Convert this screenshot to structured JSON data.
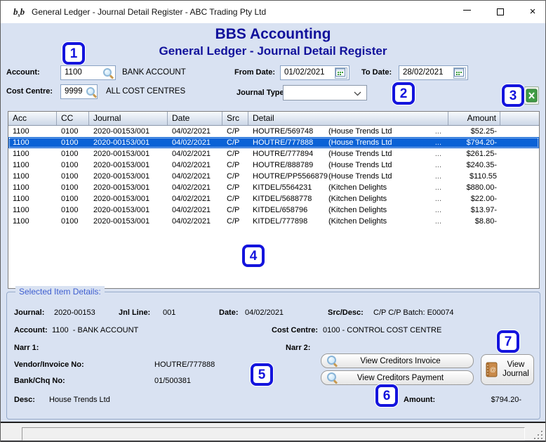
{
  "window": {
    "title": "General Ledger - Journal Detail Register - ABC Trading Pty Ltd",
    "logo_text": "b",
    "logo_sub": "s",
    "logo_text2": "b",
    "close_glyph": "×"
  },
  "header": {
    "app_title": "BBS Accounting",
    "screen_title": "General Ledger - Journal Detail Register"
  },
  "filters": {
    "account": {
      "label": "Account:",
      "value": "1100",
      "desc": "BANK ACCOUNT"
    },
    "cost_centre": {
      "label": "Cost Centre:",
      "value": "9999",
      "desc": "ALL COST CENTRES"
    },
    "from_date": {
      "label": "From Date:",
      "value": "01/02/2021"
    },
    "to_date": {
      "label": "To Date:",
      "value": "28/02/2021"
    },
    "journal_type": {
      "label": "Journal Type:",
      "value": ""
    }
  },
  "callouts": [
    "1",
    "2",
    "3",
    "4",
    "5",
    "6",
    "7"
  ],
  "table": {
    "columns": [
      "Acc",
      "CC",
      "Journal",
      "Date",
      "Src",
      "Detail",
      "Amount"
    ],
    "rows": [
      {
        "acc": "1100",
        "cc": "0100",
        "journal": "2020-00153/001",
        "date": "04/02/2021",
        "src": "C/P",
        "ref": "HOUTRE/569748",
        "name": "(House Trends Ltd",
        "dots": "...",
        "amount": "$52.25-",
        "selected": false
      },
      {
        "acc": "1100",
        "cc": "0100",
        "journal": "2020-00153/001",
        "date": "04/02/2021",
        "src": "C/P",
        "ref": "HOUTRE/777888",
        "name": "(House Trends Ltd",
        "dots": "...",
        "amount": "$794.20-",
        "selected": true
      },
      {
        "acc": "1100",
        "cc": "0100",
        "journal": "2020-00153/001",
        "date": "04/02/2021",
        "src": "C/P",
        "ref": "HOUTRE/777894",
        "name": "(House Trends Ltd",
        "dots": "...",
        "amount": "$261.25-",
        "selected": false
      },
      {
        "acc": "1100",
        "cc": "0100",
        "journal": "2020-00153/001",
        "date": "04/02/2021",
        "src": "C/P",
        "ref": "HOUTRE/888789",
        "name": "(House Trends Ltd",
        "dots": "...",
        "amount": "$240.35-",
        "selected": false
      },
      {
        "acc": "1100",
        "cc": "0100",
        "journal": "2020-00153/001",
        "date": "04/02/2021",
        "src": "C/P",
        "ref": "HOUTRE/PP5566879",
        "name": "(House Trends Ltd",
        "dots": "...",
        "amount": "$110.55",
        "selected": false
      },
      {
        "acc": "1100",
        "cc": "0100",
        "journal": "2020-00153/001",
        "date": "04/02/2021",
        "src": "C/P",
        "ref": "KITDEL/5564231",
        "name": "(Kitchen Delights",
        "dots": "...",
        "amount": "$880.00-",
        "selected": false
      },
      {
        "acc": "1100",
        "cc": "0100",
        "journal": "2020-00153/001",
        "date": "04/02/2021",
        "src": "C/P",
        "ref": "KITDEL/5688778",
        "name": "(Kitchen Delights",
        "dots": "...",
        "amount": "$22.00-",
        "selected": false
      },
      {
        "acc": "1100",
        "cc": "0100",
        "journal": "2020-00153/001",
        "date": "04/02/2021",
        "src": "C/P",
        "ref": "KITDEL/658796",
        "name": "(Kitchen Delights",
        "dots": "...",
        "amount": "$13.97-",
        "selected": false
      },
      {
        "acc": "1100",
        "cc": "0100",
        "journal": "2020-00153/001",
        "date": "04/02/2021",
        "src": "C/P",
        "ref": "KITDEL/777898",
        "name": "(Kitchen Delights",
        "dots": "...",
        "amount": "$8.80-",
        "selected": false
      }
    ]
  },
  "details": {
    "legend": "Selected Item Details:",
    "journal": {
      "label": "Journal:",
      "value": "2020-00153"
    },
    "jnl_line": {
      "label": "Jnl Line:",
      "value": "001"
    },
    "date": {
      "label": "Date:",
      "value": "04/02/2021"
    },
    "src_desc": {
      "label": "Src/Desc:",
      "value": "C/P C/P Batch: E00074"
    },
    "account": {
      "label": "Account:",
      "value": "1100  - BANK ACCOUNT"
    },
    "cost_centre": {
      "label": "Cost Centre:",
      "value": "0100 - CONTROL COST CENTRE"
    },
    "narr1": {
      "label": "Narr 1:",
      "value": ""
    },
    "narr2": {
      "label": "Narr 2:",
      "value": ""
    },
    "vendor_invoice": {
      "label": "Vendor/Invoice No:",
      "value": "HOUTRE/777888"
    },
    "bank_chq": {
      "label": "Bank/Chq No:",
      "value": "01/500381"
    },
    "desc": {
      "label": "Desc:",
      "value": "House Trends Ltd"
    },
    "amount": {
      "label": "Amount:",
      "value": "$794.20-"
    },
    "buttons": {
      "view_invoice": "View Creditors Invoice",
      "view_payment": "View Creditors Payment",
      "view_journal": "View Journal"
    }
  },
  "colors": {
    "content_bg": "#d9e2f2",
    "heading": "#11119b",
    "selection": "#0a62d6",
    "callout": "#1414dd",
    "legend": "#3f5fd0"
  }
}
